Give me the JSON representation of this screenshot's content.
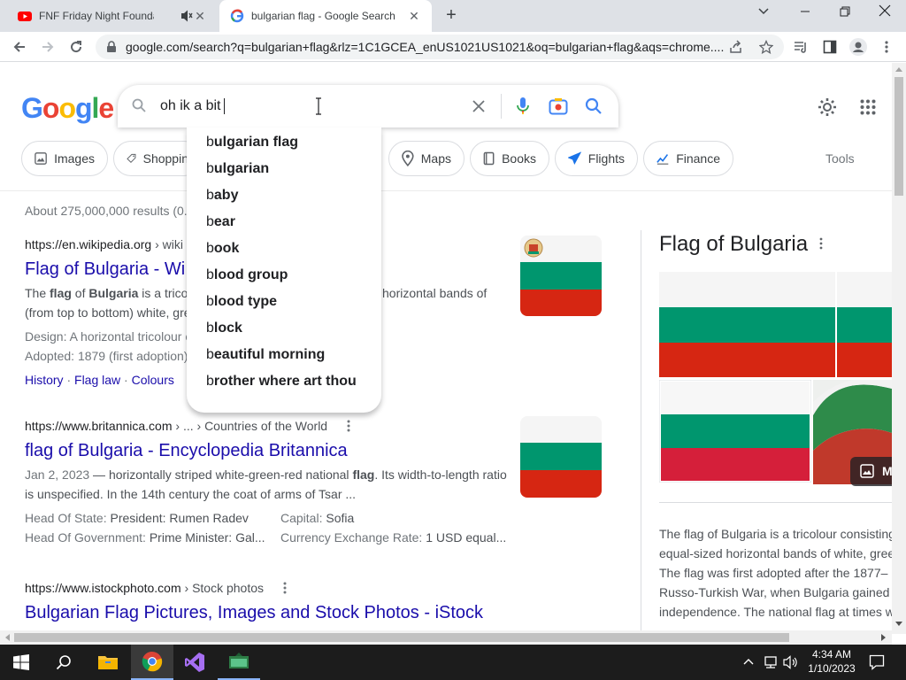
{
  "browser": {
    "tabs": [
      {
        "title": "FNF Friday Night Foundation",
        "favicon": "youtube-icon",
        "muted": true
      },
      {
        "title": "bulgarian flag - Google Search",
        "favicon": "google-icon",
        "active": true
      }
    ],
    "url": "google.com/search?q=bulgarian+flag&rlz=1C1GCEA_enUS1021US1021&oq=bulgarian+flag&aqs=chrome...."
  },
  "search": {
    "query": "oh ik a bit",
    "suggestions": [
      {
        "prefix": "b",
        "rest": "ulgarian flag"
      },
      {
        "prefix": "b",
        "rest": "ulgarian"
      },
      {
        "prefix": "b",
        "rest": "aby"
      },
      {
        "prefix": "b",
        "rest": "ear"
      },
      {
        "prefix": "b",
        "rest": "ook"
      },
      {
        "prefix": "b",
        "rest": "lood group"
      },
      {
        "prefix": "b",
        "rest": "lood type"
      },
      {
        "prefix": "b",
        "rest": "lock"
      },
      {
        "prefix": "b",
        "rest": "eautiful morning"
      },
      {
        "prefix": "b",
        "rest": "rother where art thou"
      }
    ]
  },
  "chips": {
    "images": "Images",
    "shopping": "Shoppin",
    "maps": "Maps",
    "books": "Books",
    "flights": "Flights",
    "finance": "Finance",
    "tools": "Tools"
  },
  "results": {
    "stats": "About 275,000,000 results (0.",
    "items": [
      {
        "cite": "https://en.wikipedia.org",
        "cite_path": " › wiki",
        "title": "Flag of Bulgaria - Wi",
        "snippet_1a": "The ",
        "snippet_1b": "flag",
        "snippet_1c": " of ",
        "snippet_1d": "Bulgaria",
        "snippet_1e": " is a trico",
        "snippet_1f": "horizontal bands of",
        "snippet_2": "(from top to bottom) white, gre",
        "attr_1": "Design: A horizontal tricolour o",
        "attr_2": "Adopted: 1879 (first adoption)",
        "sitelinks": [
          "History",
          "Flag law",
          "Colours"
        ]
      },
      {
        "cite": "https://www.britannica.com",
        "cite_path": " › ... › Countries of the World",
        "title": "flag of Bulgaria - Encyclopedia Britannica",
        "date": "Jan 2, 2023",
        "snippet_1a": " — horizontally striped white-green-red national ",
        "snippet_1b": "flag",
        "snippet_1c": ". Its width-to-length ratio",
        "snippet_2": "is unspecified. In the 14th century the coat of arms of Tsar ...",
        "attrs": [
          {
            "k": "Head Of State:",
            "v": " President: Rumen Radev"
          },
          {
            "k": "Capital:",
            "v": " Sofia"
          },
          {
            "k": "Head Of Government:",
            "v": " Prime Minister: Gal..."
          },
          {
            "k": "Currency Exchange Rate:",
            "v": " 1 USD equal..."
          }
        ]
      },
      {
        "cite": "https://www.istockphoto.com",
        "cite_path": " › Stock photos",
        "title": "Bulgarian Flag Pictures, Images and Stock Photos - iStock"
      }
    ]
  },
  "knowledge_panel": {
    "title": "Flag of Bulgaria",
    "more_images_label": "M",
    "lines": [
      "The flag of Bulgaria is a tricolour consisting",
      "equal-sized horizontal bands of white, gree",
      "The flag was first adopted after the 1877–",
      "Russo-Turkish War, when Bulgaria gained",
      "independence. The national flag at times w"
    ]
  },
  "taskbar": {
    "time": "4:34 AM",
    "date": "1/10/2023"
  },
  "colors": {
    "flag_white": "#f5f5f5",
    "flag_green": "#00966e",
    "flag_red": "#d62612",
    "link": "#1a0dab"
  }
}
